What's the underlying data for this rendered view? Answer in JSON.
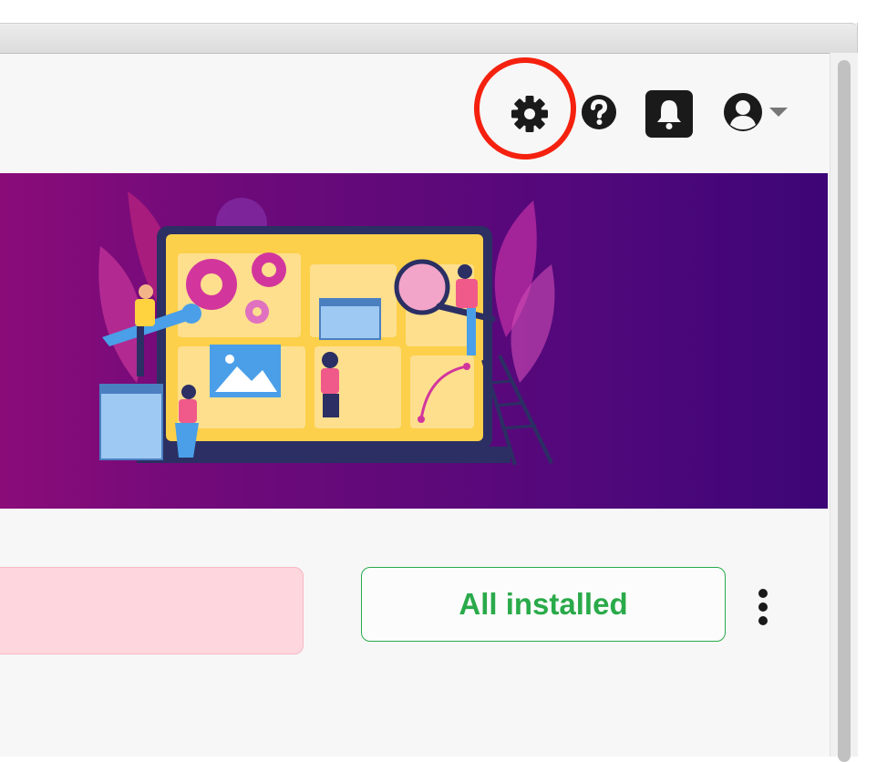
{
  "toolbar": {
    "icons": [
      "gear-icon",
      "question-circle-icon",
      "bell-icon",
      "user-circle-icon",
      "caret-down-icon"
    ]
  },
  "banner": {
    "illustration": "laptop-with-gears-and-people"
  },
  "status": {
    "button_label": "All installed"
  },
  "colors": {
    "highlight": "#f5210f",
    "success": "#2aaa4a",
    "alert_bg": "#fdd7dd",
    "banner_start": "#8a0c79",
    "banner_end": "#3d0577"
  }
}
